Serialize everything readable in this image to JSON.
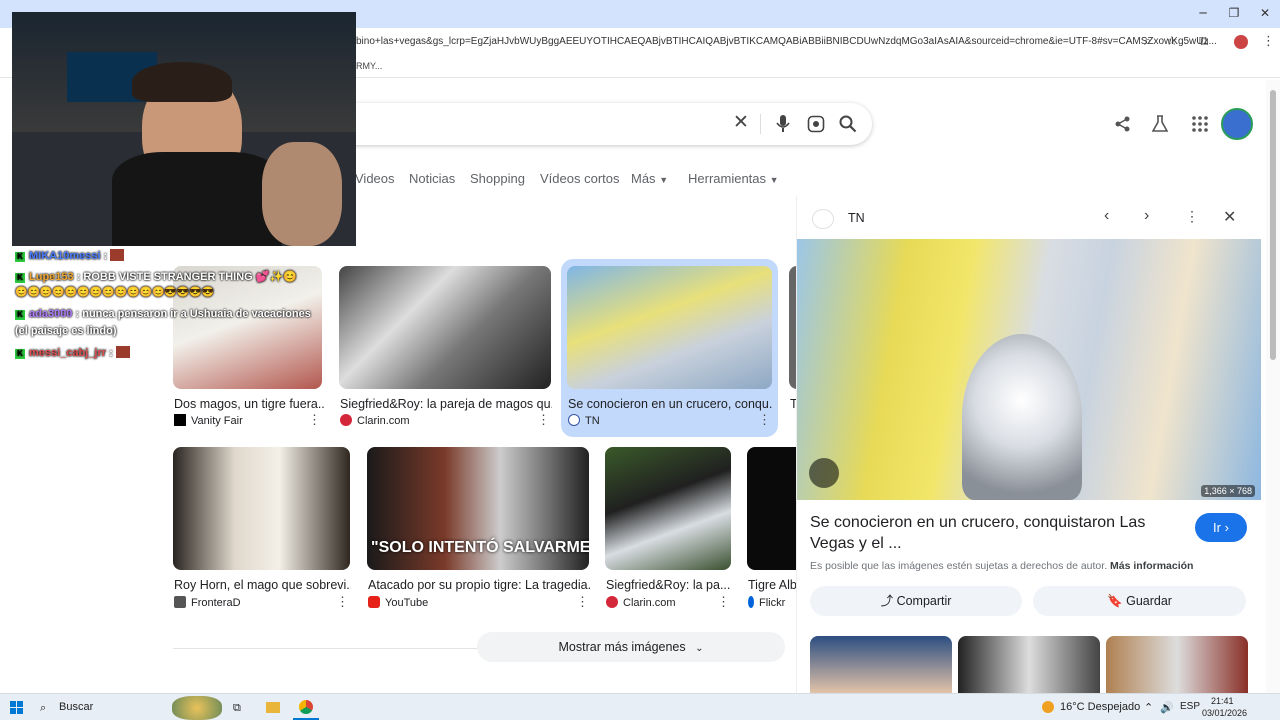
{
  "browser": {
    "url": "bino+las+vegas&gs_lcrp=EgZjaHJvbWUyBggAEEUYOTIHCAEQABjvBTIHCAIQABjvBTIKCAMQABiABBiiBNIBCDUwNzdqMGo3aIAsAIA&sourceid=chrome&ie=UTF-8#sv=CAMSZxowKg5wUz...",
    "bookmark": "RMY..."
  },
  "tabs": [
    "Videos",
    "Noticias",
    "Shopping",
    "Vídeos cortos",
    "Más",
    "Herramientas"
  ],
  "results_row1": [
    {
      "title": "Dos magos, un tigre fuera...",
      "source": "Vanity Fair"
    },
    {
      "title": "Siegfried&Roy: la pareja de magos qu...",
      "source": "Clarin.com"
    },
    {
      "title": "Se conocieron en un crucero, conqu...",
      "source": "TN"
    },
    {
      "title": "T",
      "source": ""
    }
  ],
  "results_row2": [
    {
      "title": "Roy Horn, el mago que sobrevi...",
      "source": "FronteraD",
      "thumb_text": ""
    },
    {
      "title": "Atacado por su propio tigre: La tragedia...",
      "source": "YouTube",
      "thumb_text": "\"SOLO INTENTÓ SALVARME\""
    },
    {
      "title": "Siegfried&Roy: la pa...",
      "source": "Clarin.com",
      "thumb_text": ""
    },
    {
      "title": "Tigre Albi",
      "source": "Flickr",
      "thumb_text": ""
    }
  ],
  "show_more": "Mostrar más imágenes",
  "panel": {
    "source": "TN",
    "dimensions": "1,366 × 768",
    "title": "Se conocieron en un crucero, conquistaron Las Vegas y el ...",
    "go": "Ir",
    "copyright": "Es posible que las imágenes estén sujetas a derechos de autor.",
    "more_info": "Más información",
    "share": "Compartir",
    "save": "Guardar"
  },
  "chat": [
    {
      "user": "MIKA10messi",
      "msg": ":",
      "color": "#4a7cff"
    },
    {
      "user": "Lupe153",
      "msg": ": ROBB VISTE STRANGER THING 💕✨😊",
      "color": "#f0a830"
    },
    {
      "user": "",
      "msg": "😊😊😊😊😊😊😊😊😊😊😊😊😎😎😎😎",
      "color": "#f0a830"
    },
    {
      "user": "ada3000",
      "msg": ": nunca pensaron ir a Ushuaia de vacaciones",
      "color": "#b07cff"
    },
    {
      "user": "",
      "msg": "(el paisaje es lindo)",
      "color": "#b07cff"
    },
    {
      "user": "messi_cabj_jrr",
      "msg": ":",
      "color": "#e05050"
    }
  ],
  "taskbar": {
    "search": "Buscar",
    "weather": "16°C  Despejado",
    "lang": "ESP",
    "time": "21:41",
    "date": "03/01/2026"
  }
}
